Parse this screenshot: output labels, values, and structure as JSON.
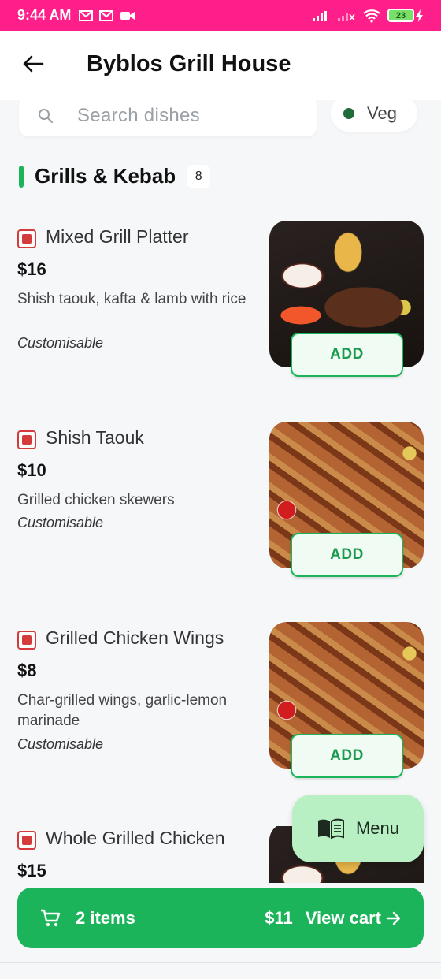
{
  "status_bar": {
    "time": "9:44 AM",
    "battery": "23"
  },
  "header": {
    "title": "Byblos Grill House"
  },
  "search": {
    "placeholder": "Search dishes"
  },
  "filter": {
    "veg_label": "Veg"
  },
  "section": {
    "title": "Grills & Kebab",
    "count": "8"
  },
  "dishes": [
    {
      "name": "Mixed Grill Platter",
      "price": "$16",
      "description": "Shish taouk, kafta & lamb with rice",
      "tag": "Customisable",
      "add_label": "ADD"
    },
    {
      "name": "Shish Taouk",
      "price": "$10",
      "description": "Grilled chicken skewers",
      "tag": "Customisable",
      "add_label": "ADD"
    },
    {
      "name": "Grilled Chicken Wings",
      "price": "$8",
      "description": "Char-grilled wings, garlic-lemon marinade",
      "tag": "Customisable",
      "add_label": "ADD"
    },
    {
      "name": "Whole Grilled Chicken",
      "price": "$15"
    }
  ],
  "menu_fab": {
    "label": "Menu"
  },
  "cart": {
    "items": "2 items",
    "total": "$11",
    "view_label": "View cart"
  },
  "colors": {
    "status_bar": "#ff1f8a",
    "accent": "#1cb45a",
    "nonveg": "#d43b3b",
    "fab": "#b8f0c4"
  }
}
